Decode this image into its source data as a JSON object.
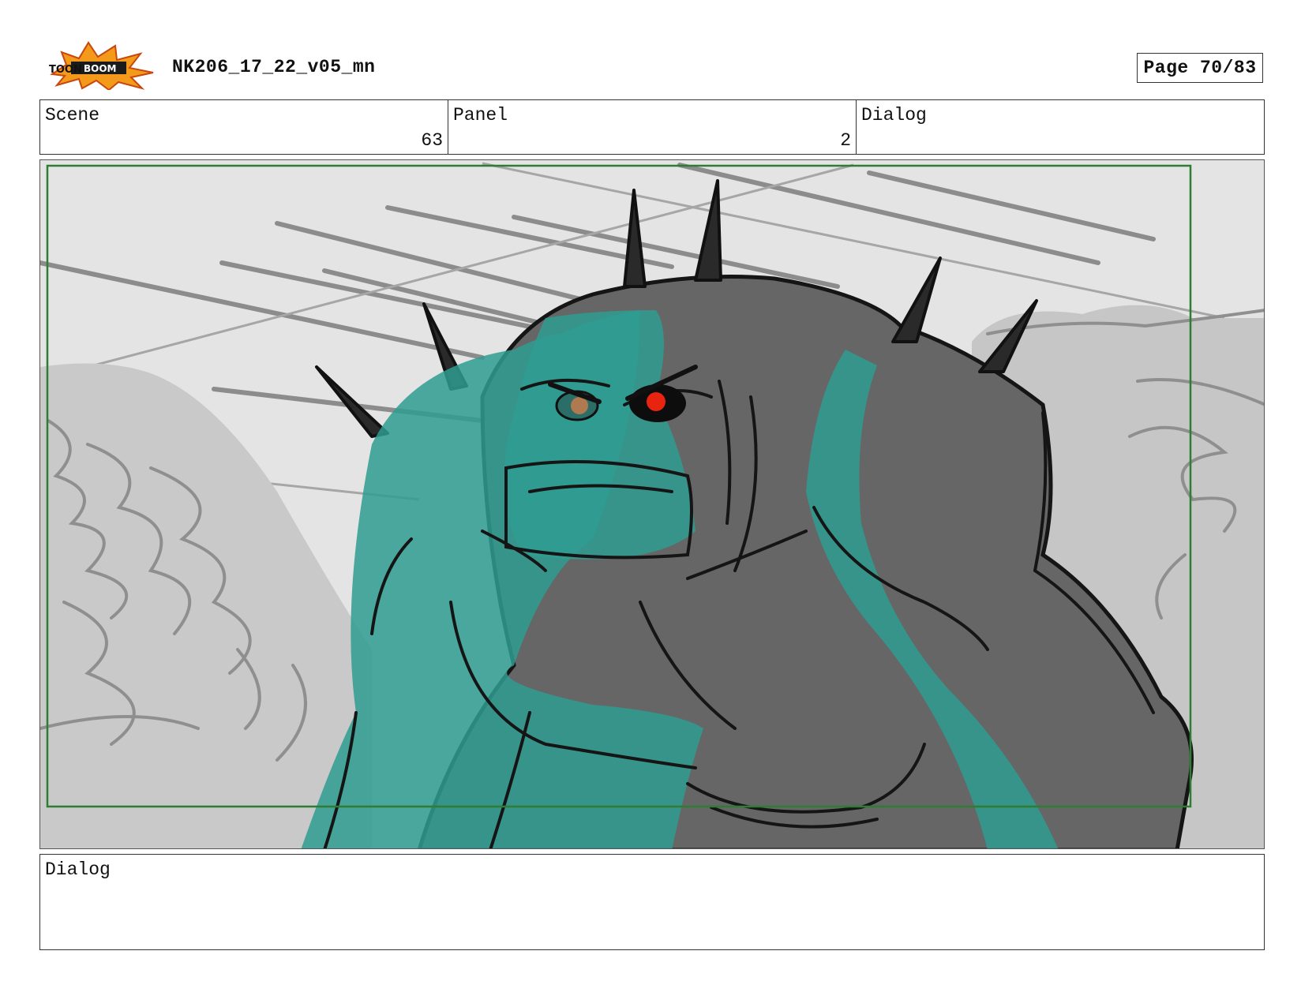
{
  "header": {
    "logo_text": "TOON BOOM",
    "document_title": "NK206_17_22_v05_mn",
    "page_indicator": "Page 70/83"
  },
  "info": {
    "scene_label": "Scene",
    "scene_value": "63",
    "panel_label": "Panel",
    "panel_value": "2",
    "dialog_label": "Dialog",
    "dialog_value": ""
  },
  "panel_image": {
    "subject": "spiked-creature-sketch",
    "colors": {
      "background": "#e4e4e4",
      "creature_gray": "#666666",
      "teal_overlay": "#3a9e94",
      "safe_frame": "#2e7d32",
      "eye_red": "#e8230f",
      "eye_brown": "#b07a50"
    }
  },
  "dialog": {
    "label": "Dialog",
    "text": ""
  }
}
